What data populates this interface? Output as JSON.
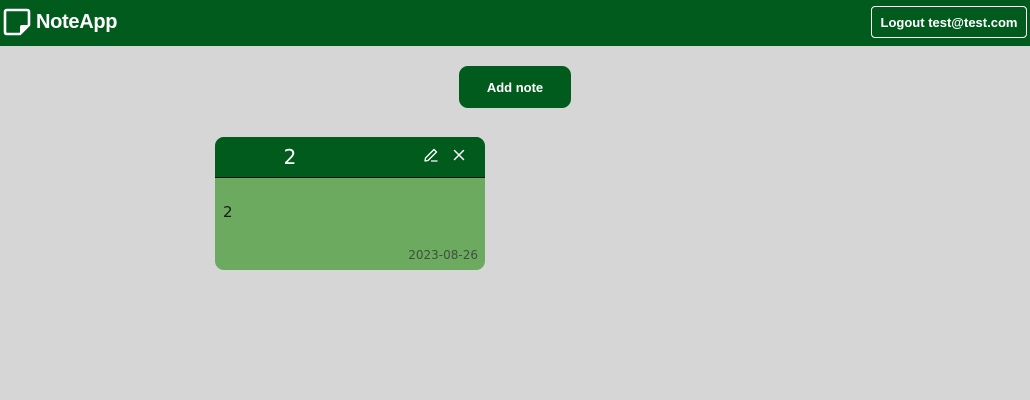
{
  "header": {
    "app_name": "NoteApp",
    "logo_icon": "note-icon",
    "logout_label": "Logout test@test.com"
  },
  "actions": {
    "add_note_label": "Add note"
  },
  "notes": [
    {
      "title": "2",
      "body": "2",
      "date": "2023-08-26",
      "edit_icon": "pencil-icon",
      "delete_icon": "close-icon"
    }
  ],
  "colors": {
    "primary_green": "#005b1d",
    "note_body_green": "#6caa5f",
    "page_background": "#d6d6d6"
  }
}
